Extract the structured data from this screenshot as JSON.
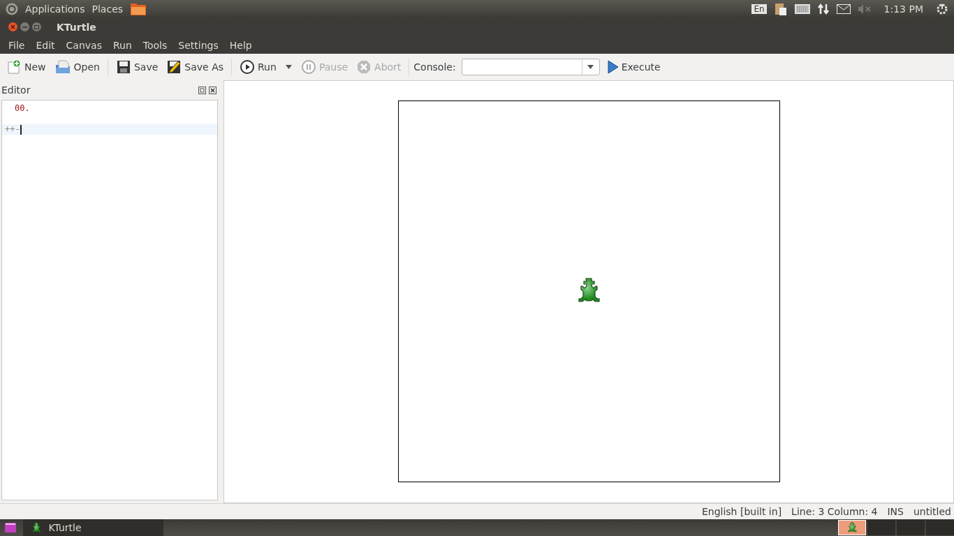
{
  "top_panel": {
    "menus": [
      "Applications",
      "Places"
    ],
    "indicator_language": "En",
    "time": "1:13 PM"
  },
  "window": {
    "title": "KTurtle"
  },
  "menu_bar": [
    "File",
    "Edit",
    "Canvas",
    "Run",
    "Tools",
    "Settings",
    "Help"
  ],
  "toolbar": {
    "items": [
      {
        "kind": "button",
        "label": "New",
        "disabled": false
      },
      {
        "kind": "button",
        "label": "Open",
        "disabled": false
      },
      {
        "kind": "separator"
      },
      {
        "kind": "button",
        "label": "Save",
        "disabled": false
      },
      {
        "kind": "button",
        "label": "Save As",
        "disabled": false
      },
      {
        "kind": "separator"
      },
      {
        "kind": "split",
        "label": "Run",
        "disabled": false
      },
      {
        "kind": "button",
        "label": "Pause",
        "disabled": true
      },
      {
        "kind": "button",
        "label": "Abort",
        "disabled": true
      },
      {
        "kind": "separator"
      }
    ],
    "console": {
      "label": "Console:"
    },
    "execute": {
      "label": "Execute",
      "disabled": false
    }
  },
  "editor": {
    "title": "Editor",
    "lines": [
      {
        "kind": "number",
        "text": "00.",
        "current": false
      },
      {
        "kind": "code",
        "text": "++-",
        "current": true
      }
    ]
  },
  "status_bar": [
    "English [built in]",
    "Line: 3 Column: 4",
    "INS",
    "untitled"
  ],
  "taskbar": {
    "task": "KTurtle",
    "workspaces": [
      {
        "selected": true
      },
      {
        "selected": false
      },
      {
        "selected": false
      },
      {
        "selected": false
      }
    ]
  }
}
